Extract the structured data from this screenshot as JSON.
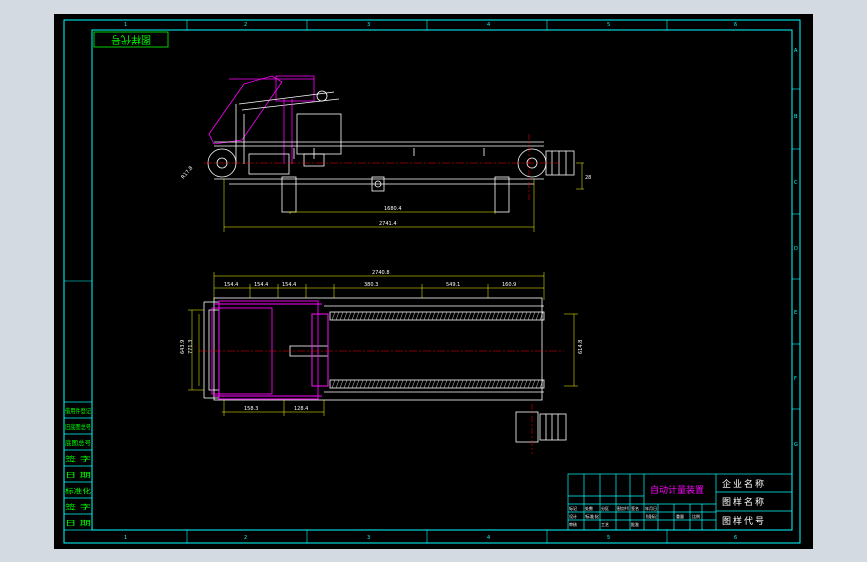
{
  "ruler": {
    "cols": [
      "1",
      "2",
      "3",
      "4",
      "5",
      "6"
    ],
    "rows": [
      "A",
      "B",
      "C",
      "D",
      "E",
      "F",
      "G"
    ]
  },
  "stamp": "图样代号",
  "side_view": {
    "dim_total": "2741.4",
    "dim_mid": "1680.4",
    "dim_left_angle": "R17.8",
    "dim_right": "28"
  },
  "top_view": {
    "dim_total": "2740.8",
    "seg1": "154.4",
    "seg2": "154.4",
    "seg3": "154.4",
    "seg4": "380.3",
    "seg5": "549.1",
    "seg6": "160.9",
    "bot1": "158.3",
    "bot2": "128.4",
    "left_h": "771.3",
    "left_h2": "643.9",
    "right_h": "614.8"
  },
  "left_block": [
    "借用件登记",
    "旧底图总号",
    "底图总号",
    "签 字",
    "日 期",
    "标准化",
    "签 字",
    "日 期"
  ],
  "title_block": {
    "drawing_name": "自动计量装置",
    "company": "企业名称",
    "pattern_name": "图样名称",
    "pattern_code": "图样代号",
    "small": [
      "标记",
      "处数",
      "分区",
      "更改文件号",
      "签名",
      "年月日",
      "设计",
      "标准化",
      "阶段标记",
      "重量",
      "比例",
      "审核",
      "工艺",
      "批准"
    ]
  },
  "colors": {
    "frame": "#00ffff",
    "drawing": "#ffffff",
    "accent": "#ff00ff",
    "text": "#00ff00",
    "center": "#ff0000",
    "inner": "#ffff00"
  }
}
